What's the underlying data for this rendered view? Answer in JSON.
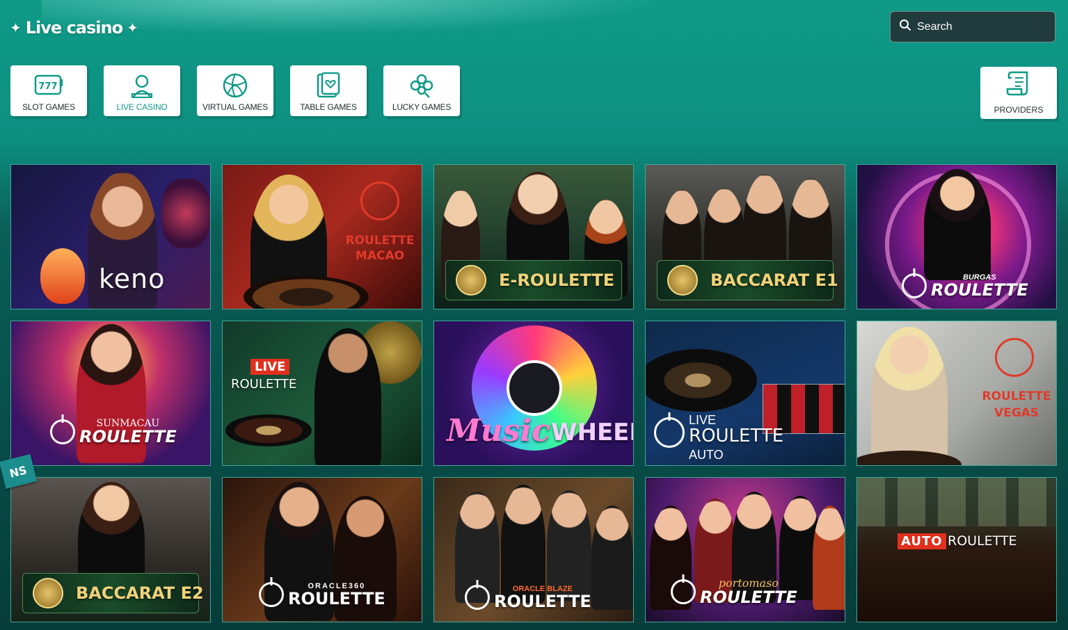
{
  "header": {
    "title": "Live casino",
    "search_placeholder": "Search"
  },
  "categories": [
    {
      "label": "SLOT GAMES",
      "icon": "slot-machine-icon",
      "active": false
    },
    {
      "label": "LIVE CASINO",
      "icon": "dealer-icon",
      "active": true
    },
    {
      "label": "VIRTUAL GAMES",
      "icon": "ball-icon",
      "active": false
    },
    {
      "label": "TABLE GAMES",
      "icon": "cards-icon",
      "active": false
    },
    {
      "label": "LUCKY GAMES",
      "icon": "clover-icon",
      "active": false
    }
  ],
  "providers": {
    "label": "PROVIDERS",
    "icon": "scroll-icon"
  },
  "corner_tag": "NS",
  "colors": {
    "accent": "#0f9a87",
    "background_top": "#0f9a87",
    "background_bottom": "#063c39"
  },
  "games": [
    {
      "title": "keno"
    },
    {
      "title": "ROULETTE MACAO"
    },
    {
      "title": "E-ROULETTE"
    },
    {
      "title": "BACCARAT E1"
    },
    {
      "title": "ROULETTE",
      "subtitle": "BURGAS"
    },
    {
      "title": "ROULETTE",
      "subtitle": "SUNMACAU"
    },
    {
      "title": "ROULETTE",
      "subtitle": "LIVE"
    },
    {
      "title": "WHEEL",
      "subtitle": "Music"
    },
    {
      "title": "ROULETTE",
      "subtitle": "LIVE",
      "extra": "AUTO"
    },
    {
      "title": "ROULETTE VEGAS"
    },
    {
      "title": "BACCARAT E2"
    },
    {
      "title": "ROULETTE",
      "subtitle": "ORACLE360"
    },
    {
      "title": "ROULETTE",
      "subtitle": "ORACLE BLAZE"
    },
    {
      "title": "ROULETTE",
      "subtitle": "portomaso"
    },
    {
      "title": "ROULETTE",
      "subtitle": "AUTO"
    }
  ]
}
